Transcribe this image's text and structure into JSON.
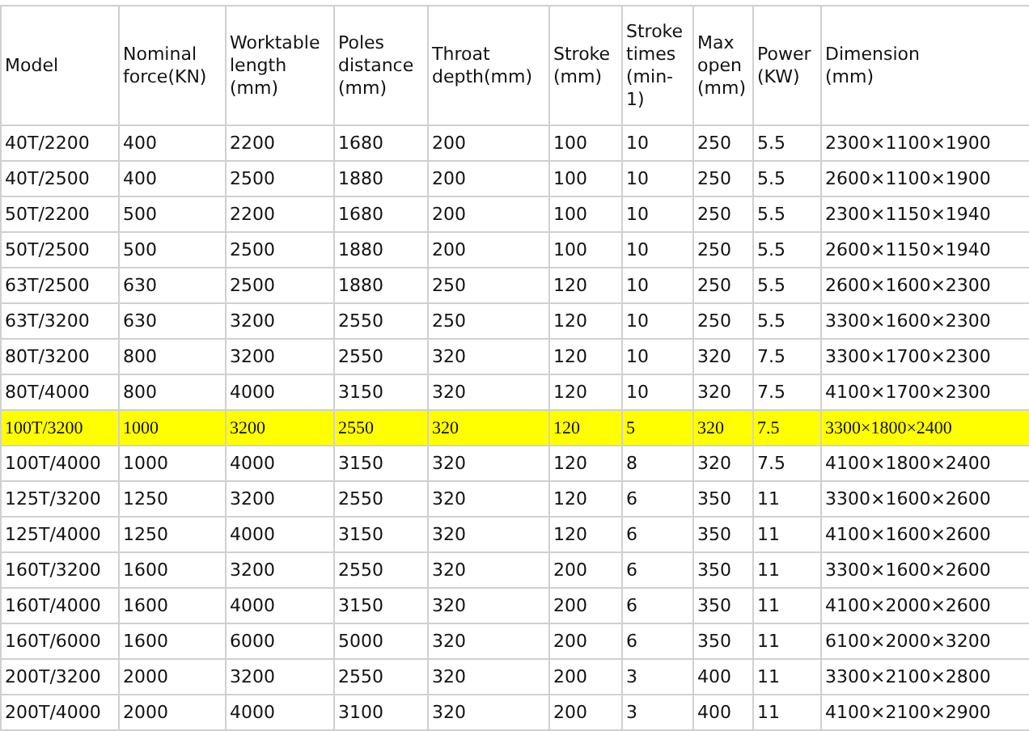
{
  "table": {
    "columns": [
      "Model",
      "Nominal\nforce(KN)",
      "Worktable\nlength\n(mm)",
      "Poles\ndistance\n(mm)",
      "Throat\ndepth(mm)",
      "Stroke\n(mm)",
      "Stroke\ntimes\n(min-\n1)",
      "Max\nopen\n(mm)",
      "Power\n(KW)",
      "Dimension\n(mm)"
    ],
    "rows": [
      {
        "highlighted": false,
        "cells": [
          "40T/2200",
          "400",
          "2200",
          "1680",
          "200",
          "100",
          "10",
          "250",
          "5.5",
          "2300×1100×1900"
        ]
      },
      {
        "highlighted": false,
        "cells": [
          "40T/2500",
          "400",
          "2500",
          "1880",
          "200",
          "100",
          "10",
          "250",
          "5.5",
          "2600×1100×1900"
        ]
      },
      {
        "highlighted": false,
        "cells": [
          "50T/2200",
          "500",
          "2200",
          "1680",
          "200",
          "100",
          "10",
          "250",
          "5.5",
          "2300×1150×1940"
        ]
      },
      {
        "highlighted": false,
        "cells": [
          "50T/2500",
          "500",
          "2500",
          "1880",
          "200",
          "100",
          "10",
          "250",
          "5.5",
          "2600×1150×1940"
        ]
      },
      {
        "highlighted": false,
        "cells": [
          "63T/2500",
          "630",
          "2500",
          "1880",
          "250",
          "120",
          "10",
          "250",
          "5.5",
          "2600×1600×2300"
        ]
      },
      {
        "highlighted": false,
        "cells": [
          "63T/3200",
          "630",
          "3200",
          "2550",
          "250",
          "120",
          "10",
          "250",
          "5.5",
          "3300×1600×2300"
        ]
      },
      {
        "highlighted": false,
        "cells": [
          "80T/3200",
          "800",
          "3200",
          "2550",
          "320",
          "120",
          "10",
          "320",
          "7.5",
          "3300×1700×2300"
        ]
      },
      {
        "highlighted": false,
        "cells": [
          "80T/4000",
          "800",
          "4000",
          "3150",
          "320",
          "120",
          "10",
          "320",
          "7.5",
          "4100×1700×2300"
        ]
      },
      {
        "highlighted": true,
        "cells": [
          "100T/3200",
          "1000",
          "3200",
          "2550",
          "320",
          "120",
          "5",
          "320",
          "7.5",
          "3300×1800×2400"
        ]
      },
      {
        "highlighted": false,
        "cells": [
          "100T/4000",
          "1000",
          "4000",
          "3150",
          "320",
          "120",
          "8",
          "320",
          "7.5",
          "4100×1800×2400"
        ]
      },
      {
        "highlighted": false,
        "cells": [
          "125T/3200",
          "1250",
          "3200",
          "2550",
          "320",
          "120",
          "6",
          "350",
          "11",
          "3300×1600×2600"
        ]
      },
      {
        "highlighted": false,
        "cells": [
          "125T/4000",
          "1250",
          "4000",
          "3150",
          "320",
          "120",
          "6",
          "350",
          "11",
          "4100×1600×2600"
        ]
      },
      {
        "highlighted": false,
        "cells": [
          "160T/3200",
          "1600",
          "3200",
          "2550",
          "320",
          "200",
          "6",
          "350",
          "11",
          "3300×1600×2600"
        ]
      },
      {
        "highlighted": false,
        "cells": [
          "160T/4000",
          "1600",
          "4000",
          "3150",
          "320",
          "200",
          "6",
          "350",
          "11",
          "4100×2000×2600"
        ]
      },
      {
        "highlighted": false,
        "cells": [
          "160T/6000",
          "1600",
          "6000",
          "5000",
          "320",
          "200",
          "6",
          "350",
          "11",
          "6100×2000×3200"
        ]
      },
      {
        "highlighted": false,
        "cells": [
          "200T/3200",
          "2000",
          "3200",
          "2550",
          "320",
          "200",
          "3",
          "400",
          "11",
          "3300×2100×2800"
        ]
      },
      {
        "highlighted": false,
        "cells": [
          "200T/4000",
          "2000",
          "4000",
          "3100",
          "320",
          "200",
          "3",
          "400",
          "11",
          "4100×2100×2900"
        ]
      }
    ]
  }
}
